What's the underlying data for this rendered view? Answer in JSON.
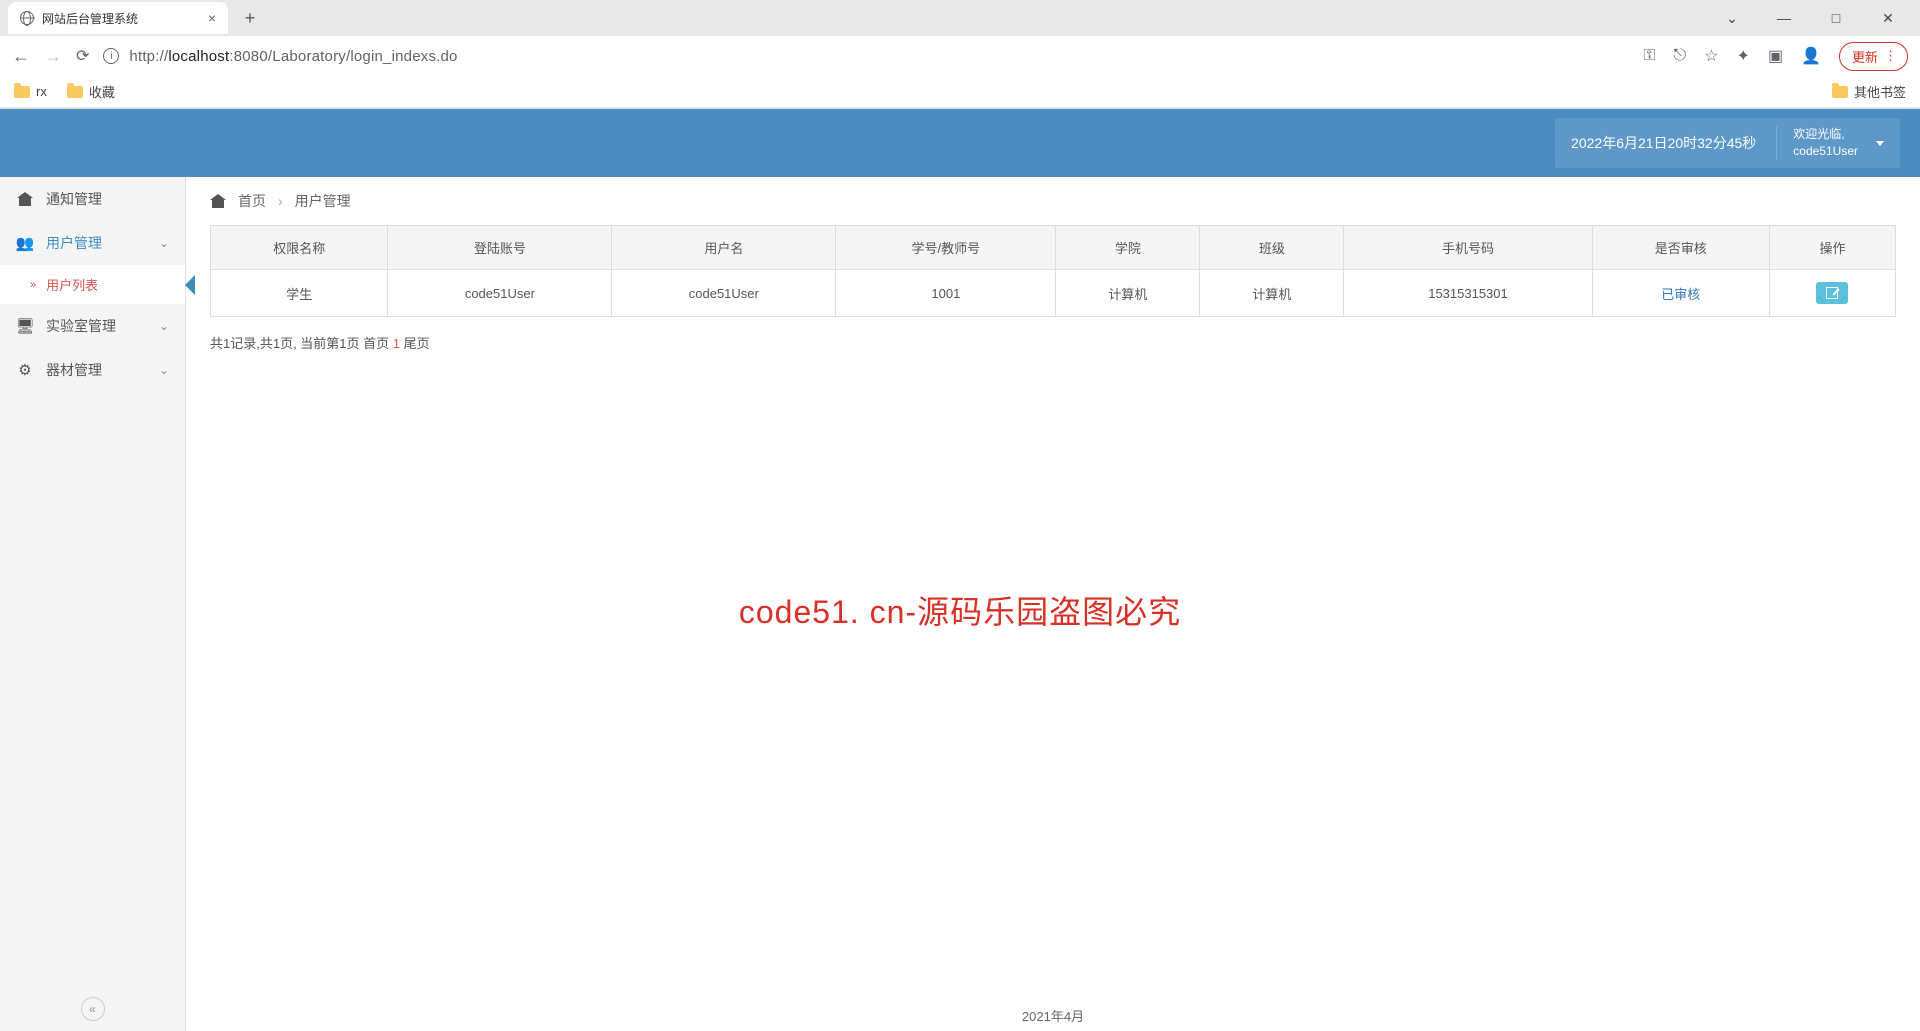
{
  "browser": {
    "tab_title": "网站后台管理系统",
    "url_host": "localhost",
    "url_port": ":8080",
    "url_path": "/Laboratory/login_indexs.do",
    "update_label": "更新",
    "bookmarks": {
      "rx": "rx",
      "fav": "收藏",
      "other": "其他书签"
    }
  },
  "header": {
    "datetime": "2022年6月21日20时32分45秒",
    "welcome": "欢迎光临,",
    "username": "code51User"
  },
  "sidebar": {
    "items": [
      {
        "label": "通知管理"
      },
      {
        "label": "用户管理"
      },
      {
        "label": "实验室管理"
      },
      {
        "label": "器材管理"
      }
    ],
    "sub_user_list": "用户列表"
  },
  "breadcrumb": {
    "home": "首页",
    "current": "用户管理"
  },
  "table": {
    "headers": [
      "权限名称",
      "登陆账号",
      "用户名",
      "学号/教师号",
      "学院",
      "班级",
      "手机号码",
      "是否审核",
      "操作"
    ],
    "rows": [
      {
        "role": "学生",
        "account": "code51User",
        "name": "code51User",
        "sid": "1001",
        "college": "计算机",
        "class": "计算机",
        "phone": "15315315301",
        "status": "已审核"
      }
    ]
  },
  "pagination": {
    "text_prefix": "共1记录,共1页, 当前第1页 首页 ",
    "page": "1",
    "text_suffix": " 尾页"
  },
  "watermark": "code51. cn-源码乐园盗图必究",
  "footer": "2021年4月"
}
